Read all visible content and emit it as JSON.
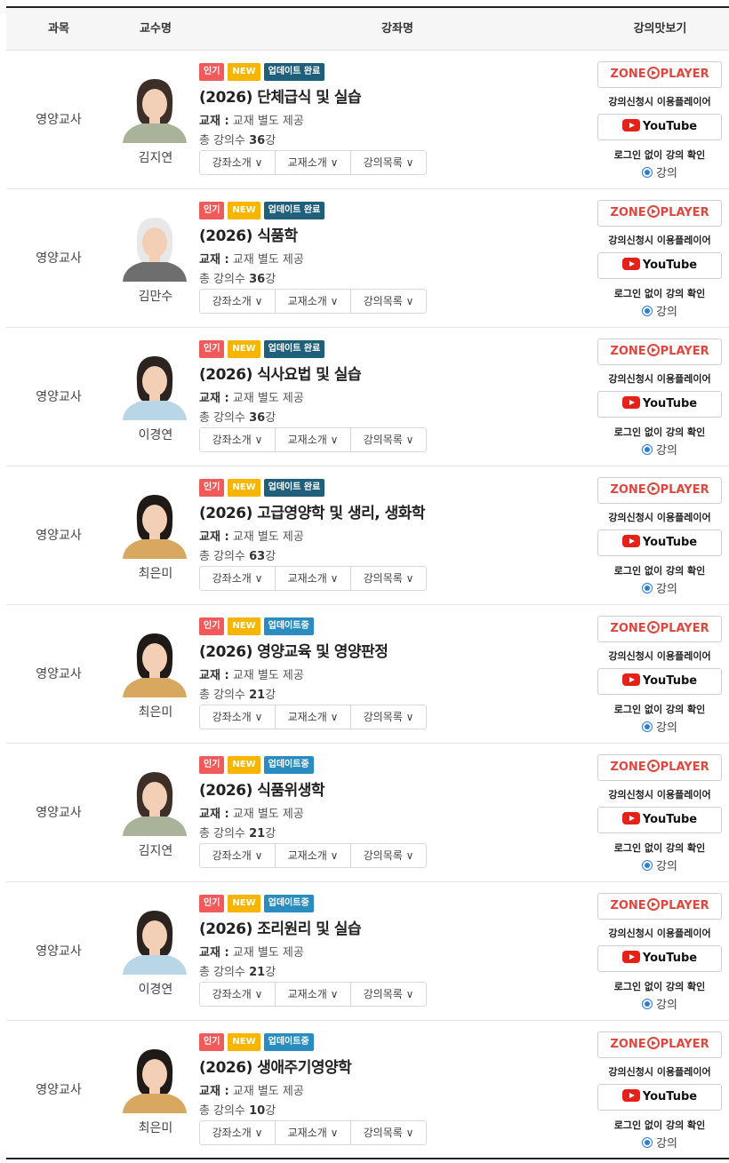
{
  "header": {
    "subject": "과목",
    "professor": "교수명",
    "course": "강좌명",
    "preview": "강의맛보기"
  },
  "labels": {
    "book_label": "교재 :",
    "book_value": "교재 별도 제공",
    "count_prefix": "총 강의수",
    "count_suffix": "강",
    "btn_intro": "강좌소개 ∨",
    "btn_book": "교재소개 ∨",
    "btn_list": "강의목록 ∨",
    "zone_left": "ZONE",
    "zone_right": "PLAYER",
    "player_note": "강의신청시 이용플레이어",
    "youtube": "YouTube",
    "login_note": "로그인 없이 강의 확인",
    "radio": "강의",
    "badge_pop": "인기",
    "badge_new": "NEW",
    "badge_done": "업데이트 완료",
    "badge_ing": "업데이트중"
  },
  "colors": {
    "badge_pop": "#f05a5a",
    "badge_new": "#f7b500",
    "badge_done": "#1f5f7a",
    "badge_ing": "#2a8cbf",
    "zone_red": "#e0463e"
  },
  "rows": [
    {
      "subject": "영양교사",
      "professor": "김지연",
      "title": "(2026) 단체급식 및 실습",
      "count": "36",
      "status": "done"
    },
    {
      "subject": "영양교사",
      "professor": "김만수",
      "title": "(2026) 식품학",
      "count": "36",
      "status": "done"
    },
    {
      "subject": "영양교사",
      "professor": "이경연",
      "title": "(2026) 식사요법 및 실습",
      "count": "36",
      "status": "done"
    },
    {
      "subject": "영양교사",
      "professor": "최은미",
      "title": "(2026) 고급영양학 및 생리, 생화학",
      "count": "63",
      "status": "done"
    },
    {
      "subject": "영양교사",
      "professor": "최은미",
      "title": "(2026) 영양교육 및 영양판정",
      "count": "21",
      "status": "ing"
    },
    {
      "subject": "영양교사",
      "professor": "김지연",
      "title": "(2026) 식품위생학",
      "count": "21",
      "status": "ing"
    },
    {
      "subject": "영양교사",
      "professor": "이경연",
      "title": "(2026) 조리원리 및 실습",
      "count": "21",
      "status": "ing"
    },
    {
      "subject": "영양교사",
      "professor": "최은미",
      "title": "(2026) 생애주기영양학",
      "count": "10",
      "status": "ing"
    }
  ]
}
